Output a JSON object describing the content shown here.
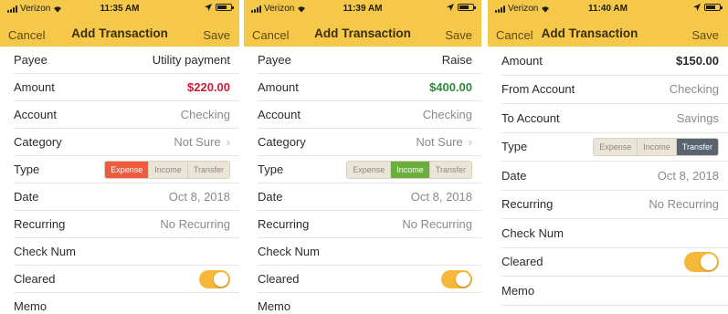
{
  "colors": {
    "header_bg": "#f5c84a",
    "expense": "#ef5b3f",
    "income": "#6aae3d",
    "transfer": "#5a6470",
    "amount_negative": "#c8203a",
    "amount_positive": "#2f8a3a",
    "toggle_on": "#f5b83a"
  },
  "screens": [
    {
      "status": {
        "carrier": "Verizon",
        "time": "11:35 AM"
      },
      "nav": {
        "cancel": "Cancel",
        "title": "Add Transaction",
        "save": "Save"
      },
      "rows": {
        "payee": {
          "label": "Payee",
          "value": "Utility payment"
        },
        "amount": {
          "label": "Amount",
          "value": "$220.00"
        },
        "account": {
          "label": "Account",
          "value": "Checking"
        },
        "category": {
          "label": "Category",
          "value": "Not Sure",
          "chevron": "›"
        },
        "type": {
          "label": "Type",
          "options": [
            "Expense",
            "Income",
            "Transfer"
          ],
          "selected": "Expense"
        },
        "date": {
          "label": "Date",
          "value": "Oct 8, 2018"
        },
        "recurring": {
          "label": "Recurring",
          "value": "No Recurring"
        },
        "check_num": {
          "label": "Check Num"
        },
        "cleared": {
          "label": "Cleared",
          "on": true
        },
        "memo": {
          "label": "Memo"
        }
      }
    },
    {
      "status": {
        "carrier": "Verizon",
        "time": "11:39 AM"
      },
      "nav": {
        "cancel": "Cancel",
        "title": "Add Transaction",
        "save": "Save"
      },
      "rows": {
        "payee": {
          "label": "Payee",
          "value": "Raise"
        },
        "amount": {
          "label": "Amount",
          "value": "$400.00"
        },
        "account": {
          "label": "Account",
          "value": "Checking"
        },
        "category": {
          "label": "Category",
          "value": "Not Sure",
          "chevron": "›"
        },
        "type": {
          "label": "Type",
          "options": [
            "Expense",
            "Income",
            "Transfer"
          ],
          "selected": "Income"
        },
        "date": {
          "label": "Date",
          "value": "Oct 8, 2018"
        },
        "recurring": {
          "label": "Recurring",
          "value": "No Recurring"
        },
        "check_num": {
          "label": "Check Num"
        },
        "cleared": {
          "label": "Cleared",
          "on": true
        },
        "memo": {
          "label": "Memo"
        }
      }
    },
    {
      "status": {
        "carrier": "Verizon",
        "time": "11:40 AM"
      },
      "nav": {
        "cancel": "Cancel",
        "title": "Add Transaction",
        "save": "Save"
      },
      "rows": {
        "amount": {
          "label": "Amount",
          "value": "$150.00"
        },
        "from_account": {
          "label": "From Account",
          "value": "Checking"
        },
        "to_account": {
          "label": "To Account",
          "value": "Savings"
        },
        "type": {
          "label": "Type",
          "options": [
            "Expense",
            "Income",
            "Transfer"
          ],
          "selected": "Transfer"
        },
        "date": {
          "label": "Date",
          "value": "Oct 8, 2018"
        },
        "recurring": {
          "label": "Recurring",
          "value": "No Recurring"
        },
        "check_num": {
          "label": "Check Num"
        },
        "cleared": {
          "label": "Cleared",
          "on": true
        },
        "memo": {
          "label": "Memo"
        }
      }
    }
  ]
}
